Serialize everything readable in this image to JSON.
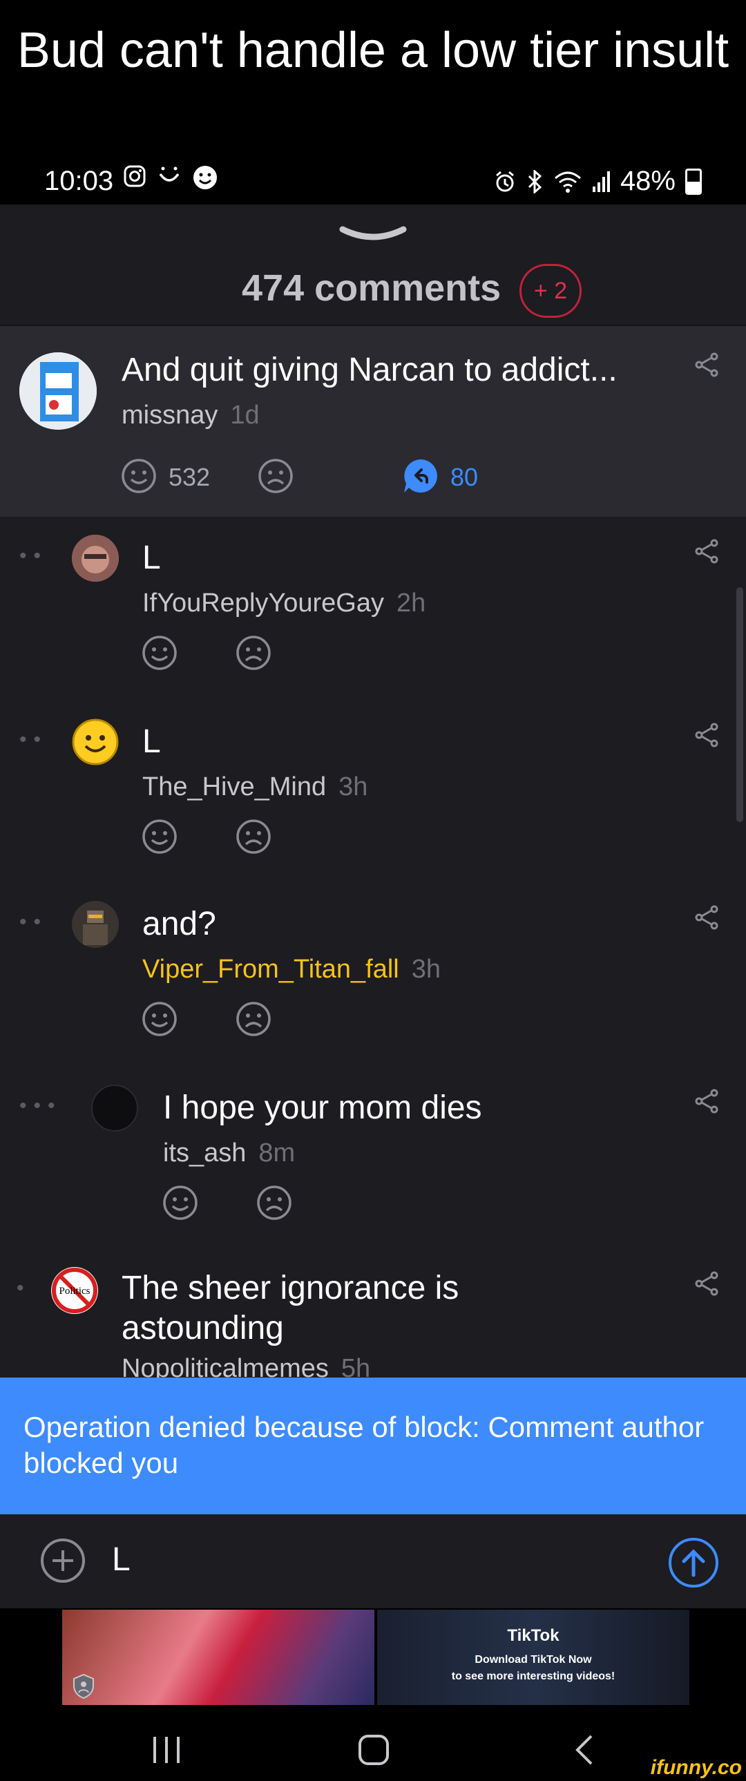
{
  "meme": {
    "title": "Bud can't handle a low tier insult"
  },
  "status_bar": {
    "time": "10:03",
    "battery": "48%"
  },
  "comments_header": {
    "count_label": "474 comments",
    "new_badge": "+ 2"
  },
  "root_comment": {
    "text": "And quit giving Narcan to addict...",
    "author": "missnay",
    "time": "1d",
    "smile_count": "532",
    "reply_count": "80"
  },
  "replies": [
    {
      "text": "L",
      "author": "IfYouReplyYoureGay",
      "time": "2h",
      "author_color": "#c8c8cc"
    },
    {
      "text": "L",
      "author": "The_Hive_Mind",
      "time": "3h",
      "author_color": "#c8c8cc"
    },
    {
      "text": "and?",
      "author": "Viper_From_Titan_fall",
      "time": "3h",
      "author_color": "#f5c31a"
    },
    {
      "text": "I hope your mom dies",
      "author": "its_ash",
      "time": "8m",
      "author_color": "#c8c8cc"
    },
    {
      "text_line1": "The sheer ignorance is",
      "text_line2": "astounding",
      "author": "Nopoliticalmemes",
      "time": "5h",
      "avatar_label": "Politics",
      "author_color": "#c8c8cc"
    }
  ],
  "toast": {
    "message": "Operation denied because of block: Comment author blocked you"
  },
  "input": {
    "value": "L"
  },
  "ad": {
    "brand": "TikTok",
    "line1": "Download TikTok Now",
    "line2": "to see more interesting videos!"
  },
  "watermark": "ifunny.co",
  "colors": {
    "accent": "#3d8bfd",
    "toast": "#3d8bfd",
    "badge": "#e0304a",
    "highlight_name": "#f5c31a"
  }
}
